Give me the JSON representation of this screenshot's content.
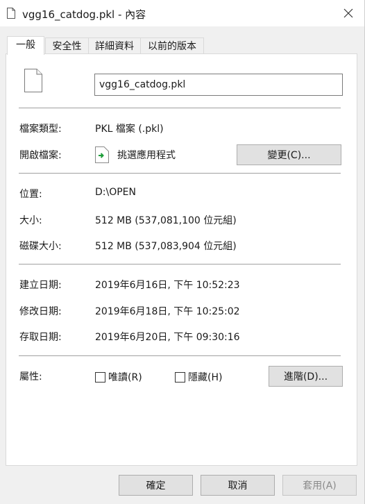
{
  "window": {
    "title": "vgg16_catdog.pkl - 內容",
    "close_icon": "close-icon"
  },
  "tabs": [
    {
      "label": "一般",
      "active": true
    },
    {
      "label": "安全性",
      "active": false
    },
    {
      "label": "詳細資料",
      "active": false
    },
    {
      "label": "以前的版本",
      "active": false
    }
  ],
  "general": {
    "file_name": "vgg16_catdog.pkl",
    "file_type_label": "檔案類型:",
    "file_type_value": "PKL 檔案 (.pkl)",
    "opens_with_label": "開啟檔案:",
    "opens_with_value": "挑選應用程式",
    "change_button": "變更(C)...",
    "location_label": "位置:",
    "location_value": "D:\\OPEN",
    "size_label": "大小:",
    "size_value": "512 MB (537,081,100 位元組)",
    "size_on_disk_label": "磁碟大小:",
    "size_on_disk_value": "512 MB (537,083,904 位元組)",
    "created_label": "建立日期:",
    "created_value": "2019年6月16日, 下午 10:52:23",
    "modified_label": "修改日期:",
    "modified_value": "2019年6月18日, 下午 10:25:02",
    "accessed_label": "存取日期:",
    "accessed_value": "2019年6月20日, 下午 09:30:16",
    "attributes_label": "屬性:",
    "readonly_label": "唯讀(R)",
    "readonly_checked": false,
    "hidden_label": "隱藏(H)",
    "hidden_checked": false,
    "advanced_button": "進階(D)..."
  },
  "footer": {
    "ok": "確定",
    "cancel": "取消",
    "apply": "套用(A)",
    "apply_enabled": false
  },
  "colors": {
    "window_bg": "#f0f0f0",
    "panel_bg": "#ffffff",
    "button_bg": "#e1e1e1",
    "app_icon_accent": "#1e9e3a"
  }
}
